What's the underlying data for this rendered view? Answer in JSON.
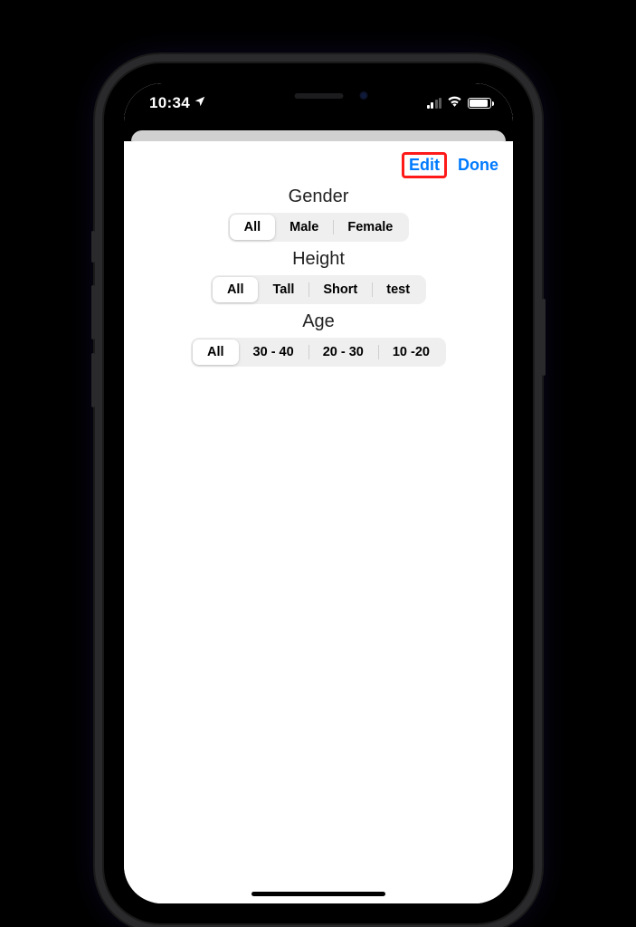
{
  "status": {
    "time": "10:34",
    "location_icon": "location-arrow"
  },
  "nav": {
    "edit_label": "Edit",
    "done_label": "Done"
  },
  "groups": [
    {
      "title": "Gender",
      "selected": 0,
      "options": [
        "All",
        "Male",
        "Female"
      ]
    },
    {
      "title": "Height",
      "selected": 0,
      "options": [
        "All",
        "Tall",
        "Short",
        "test"
      ]
    },
    {
      "title": "Age",
      "selected": 0,
      "options": [
        "All",
        "30 - 40",
        "20 - 30",
        "10 -20"
      ]
    }
  ],
  "highlight": {
    "target": "edit-button",
    "color": "#ff1a1a"
  }
}
